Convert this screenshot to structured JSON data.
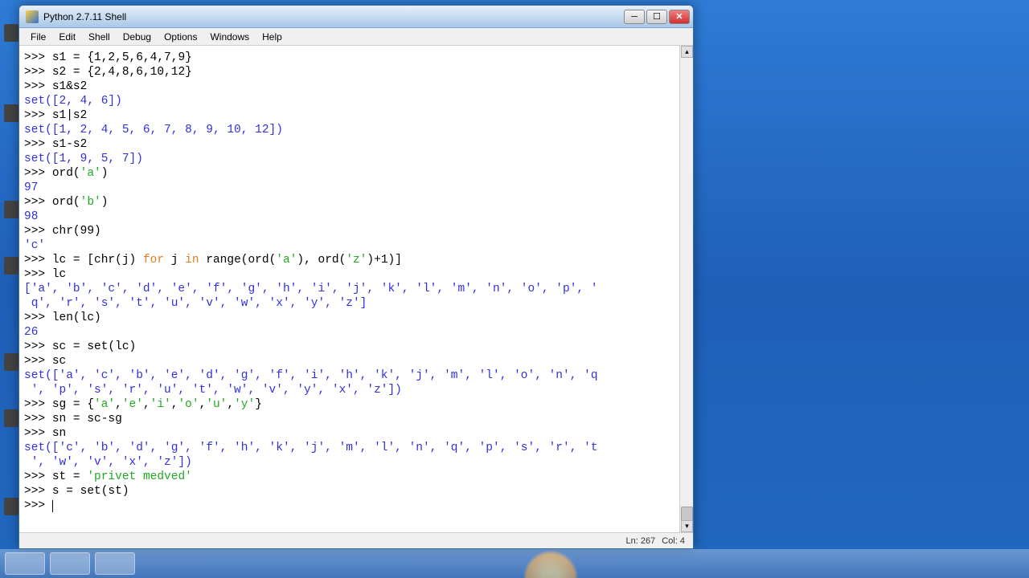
{
  "window": {
    "title": "Python 2.7.11 Shell"
  },
  "menu": {
    "file": "File",
    "edit": "Edit",
    "shell": "Shell",
    "debug": "Debug",
    "options": "Options",
    "windows": "Windows",
    "help": "Help"
  },
  "terminal": {
    "lines": [
      {
        "t": "in",
        "text": "s1 = {1,2,5,6,4,7,9}"
      },
      {
        "t": "in",
        "text": "s2 = {2,4,8,6,10,12}"
      },
      {
        "t": "in",
        "text": "s1&s2"
      },
      {
        "t": "out",
        "text": "set([2, 4, 6])"
      },
      {
        "t": "in",
        "text": "s1|s2"
      },
      {
        "t": "out",
        "text": "set([1, 2, 4, 5, 6, 7, 8, 9, 10, 12])"
      },
      {
        "t": "in",
        "text": "s1-s2"
      },
      {
        "t": "out",
        "text": "set([1, 9, 5, 7])"
      },
      {
        "t": "in",
        "text": "ord('a')",
        "str_ranges": [
          [
            4,
            7
          ]
        ]
      },
      {
        "t": "out",
        "text": "97"
      },
      {
        "t": "in",
        "text": "ord('b')",
        "str_ranges": [
          [
            4,
            7
          ]
        ]
      },
      {
        "t": "out",
        "text": "98"
      },
      {
        "t": "in",
        "text": "chr(99)"
      },
      {
        "t": "out",
        "text": "'c'"
      },
      {
        "t": "in",
        "text": "lc = [chr(j) for j in range(ord('a'), ord('z')+1)]",
        "kw_ranges": [
          [
            13,
            16
          ],
          [
            19,
            21
          ]
        ],
        "str_ranges": [
          [
            32,
            35
          ],
          [
            42,
            45
          ]
        ]
      },
      {
        "t": "in",
        "text": "lc"
      },
      {
        "t": "out",
        "text": "['a', 'b', 'c', 'd', 'e', 'f', 'g', 'h', 'i', 'j', 'k', 'l', 'm', 'n', 'o', 'p', 'q', 'r', 's', 't', 'u', 'v', 'w', 'x', 'y', 'z']"
      },
      {
        "t": "in",
        "text": "len(lc)"
      },
      {
        "t": "out",
        "text": "26"
      },
      {
        "t": "in",
        "text": "sc = set(lc)"
      },
      {
        "t": "in",
        "text": "sc"
      },
      {
        "t": "out",
        "text": "set(['a', 'c', 'b', 'e', 'd', 'g', 'f', 'i', 'h', 'k', 'j', 'm', 'l', 'o', 'n', 'q', 'p', 's', 'r', 'u', 't', 'w', 'v', 'y', 'x', 'z'])"
      },
      {
        "t": "in",
        "text": "sg = {'a','e','i','o','u','y'}",
        "str_ranges": [
          [
            6,
            9
          ],
          [
            10,
            13
          ],
          [
            14,
            17
          ],
          [
            18,
            21
          ],
          [
            22,
            25
          ],
          [
            26,
            29
          ]
        ]
      },
      {
        "t": "in",
        "text": "sn = sc-sg"
      },
      {
        "t": "in",
        "text": "sn"
      },
      {
        "t": "out",
        "text": "set(['c', 'b', 'd', 'g', 'f', 'h', 'k', 'j', 'm', 'l', 'n', 'q', 'p', 's', 'r', 't', 'w', 'v', 'x', 'z'])"
      },
      {
        "t": "in",
        "text": "st = 'privet medved'",
        "str_ranges": [
          [
            5,
            20
          ]
        ]
      },
      {
        "t": "in",
        "text": "s = set(st)"
      },
      {
        "t": "prompt",
        "text": ""
      }
    ]
  },
  "status": {
    "line": "Ln: 267",
    "col": "Col: 4"
  }
}
